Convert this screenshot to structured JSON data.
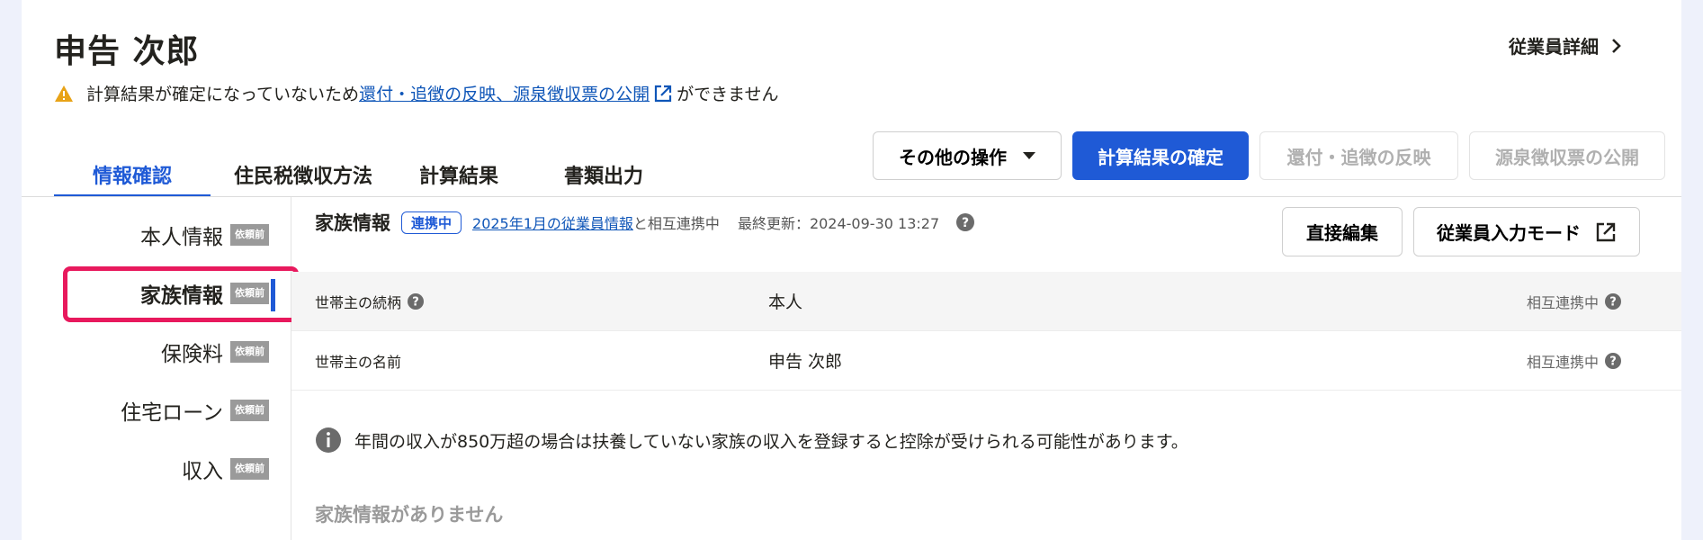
{
  "header": {
    "employee_name": "申告 次郎",
    "detail_link": "従業員詳細"
  },
  "warning": {
    "prefix": "計算結果が確定になっていないため",
    "link": "還付・追徴の反映、源泉徴収票の公開",
    "suffix": "ができません"
  },
  "tabs": [
    {
      "label": "情報確認",
      "active": true
    },
    {
      "label": "住民税徴収方法",
      "active": false
    },
    {
      "label": "計算結果",
      "active": false
    },
    {
      "label": "書類出力",
      "active": false
    }
  ],
  "actions": {
    "other": "その他の操作",
    "confirm": "計算結果の確定",
    "refund": "還付・追徴の反映",
    "publish": "源泉徴収票の公開"
  },
  "sidenav": {
    "items": [
      {
        "label": "本人情報",
        "badge": "依頼前"
      },
      {
        "label": "家族情報",
        "badge": "依頼前",
        "active": true
      },
      {
        "label": "保険料",
        "badge": "依頼前"
      },
      {
        "label": "住宅ローン",
        "badge": "依頼前"
      },
      {
        "label": "収入",
        "badge": "依頼前"
      }
    ]
  },
  "section": {
    "title": "家族情報",
    "status_chip": "連携中",
    "link_text": "2025年1月の従業員情報",
    "link_suffix": "と相互連携中",
    "last_updated": "最終更新：2024-09-30 13:27",
    "direct_edit": "直接編集",
    "employee_input_mode": "従業員入力モード"
  },
  "rows": [
    {
      "label": "世帯主の続柄",
      "value": "本人",
      "status": "相互連携中"
    },
    {
      "label": "世帯主の名前",
      "value": "申告 次郎",
      "status": "相互連携中"
    }
  ],
  "notice": "年間の収入が850万超の場合は扶養していない家族の収入を登録すると控除が受けられる可能性があります。",
  "empty_message": "家族情報がありません",
  "colors": {
    "primary": "#1f5ad6",
    "link": "#0f56b8",
    "warning": "#e8a317",
    "highlight": "#e8195d",
    "badge": "#9a9a9a"
  }
}
